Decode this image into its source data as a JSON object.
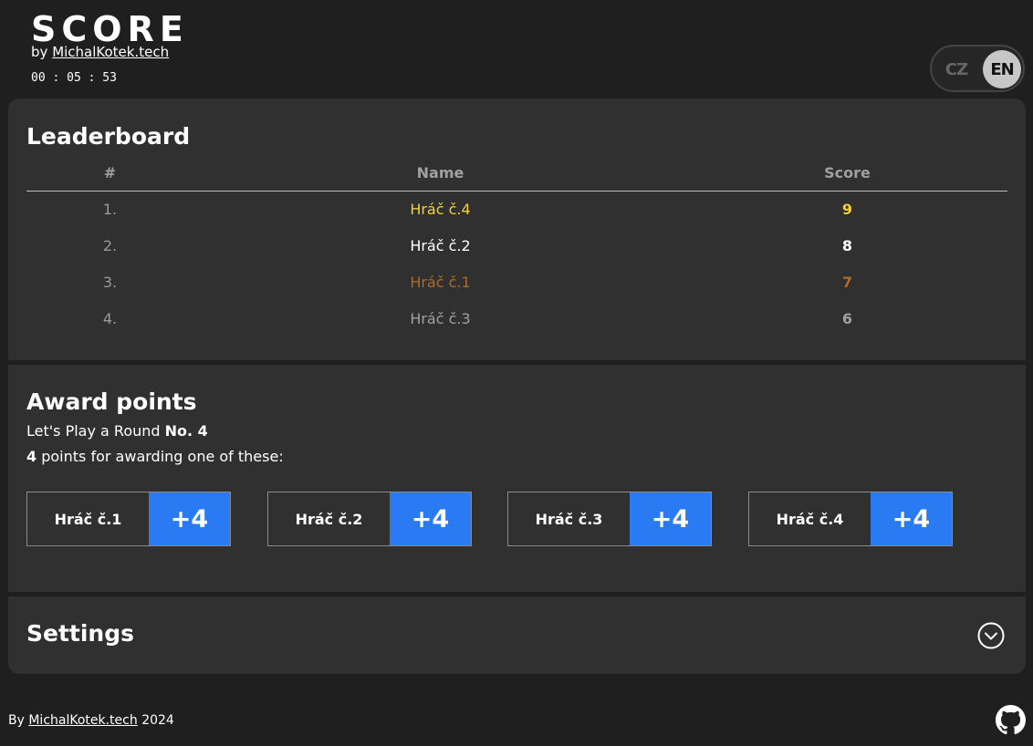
{
  "header": {
    "logo": "SCORE",
    "by_prefix": "by",
    "by_link": "MichalKotek.tech",
    "timer": "00 : 05 : 53"
  },
  "language": {
    "options": [
      "CZ",
      "EN"
    ],
    "selected": "EN"
  },
  "leaderboard": {
    "title": "Leaderboard",
    "columns": [
      "#",
      "Name",
      "Score"
    ],
    "rows": [
      {
        "rank": "1.",
        "name": "Hráč č.4",
        "score": "9",
        "color": "#f2d035"
      },
      {
        "rank": "2.",
        "name": "Hráč č.2",
        "score": "8",
        "color": "#ffffff"
      },
      {
        "rank": "3.",
        "name": "Hráč č.1",
        "score": "7",
        "color": "#b06b25"
      },
      {
        "rank": "4.",
        "name": "Hráč č.3",
        "score": "6",
        "color": "#a0a0a0"
      }
    ]
  },
  "award": {
    "title": "Award points",
    "round_prefix": "Let's Play a Round",
    "round_value": "No. 4",
    "points_value": "4",
    "points_suffix": "points for awarding one of these:",
    "buttons": [
      {
        "name": "Hráč č.1",
        "plus": "+4"
      },
      {
        "name": "Hráč č.2",
        "plus": "+4"
      },
      {
        "name": "Hráč č.3",
        "plus": "+4"
      },
      {
        "name": "Hráč č.4",
        "plus": "+4"
      }
    ],
    "accent": "#2a7af4"
  },
  "settings": {
    "title": "Settings",
    "icon": "chevron-down-icon"
  },
  "footer": {
    "prefix": "By",
    "link": "MichalKotek.tech",
    "year": "2024",
    "icon": "github-icon"
  }
}
